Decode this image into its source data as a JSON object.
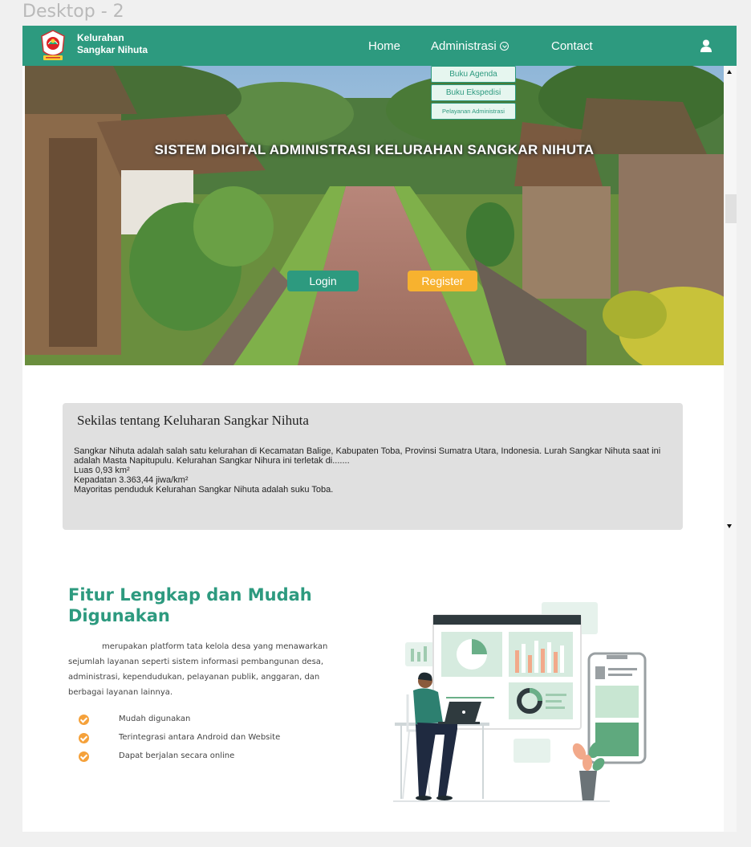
{
  "frame": {
    "label": "Desktop - 2"
  },
  "brand": {
    "line1": "Kelurahan",
    "line2": "Sangkar Nihuta"
  },
  "nav": {
    "home": "Home",
    "administrasi": "Administrasi",
    "contact": "Contact"
  },
  "dropdown": [
    "Buku Agenda",
    "Buku Ekspedisi",
    "Pelayanan Administrasi"
  ],
  "hero": {
    "title": "SISTEM DIGITAL ADMINISTRASI KELURAHAN SANGKAR NIHUTA",
    "login": "Login",
    "register": "Register"
  },
  "about": {
    "title": "Sekilas tentang Keluharan Sangkar Nihuta",
    "lines": [
      "Sangkar Nihuta adalah salah satu kelurahan di Kecamatan Balige, Kabupaten Toba, Provinsi Sumatra Utara, Indonesia. Lurah Sangkar Nihuta saat ini adalah Masta Napitupulu. Kelurahan Sangkar Nihura ini terletak di.......",
      " Luas 0,93 km²",
      "Kepadatan 3.363,44 jiwa/km²",
      "Mayoritas penduduk Kelurahan Sangkar Nihuta adalah suku Toba."
    ]
  },
  "features": {
    "title": "Fitur Lengkap dan Mudah Digunakan",
    "description": "merupakan platform tata kelola desa yang menawarkan sejumlah layanan seperti sistem informasi pembangunan desa, administrasi, kependudukan, pelayanan publik, anggaran, dan berbagai layanan lainnya.",
    "items": [
      "Mudah digunakan",
      "Terintegrasi antara Android dan Website",
      "Dapat berjalan secara online"
    ]
  },
  "colors": {
    "primary": "#2d9a7f",
    "accent": "#f7b22f",
    "check": "#f5a13a",
    "card": "#e0e0e0"
  }
}
